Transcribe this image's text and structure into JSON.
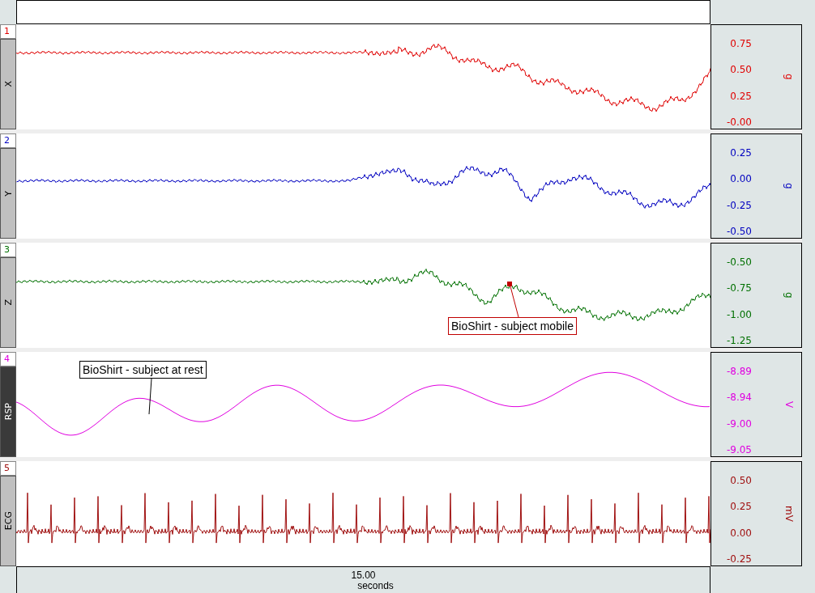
{
  "channels": [
    {
      "number": "1",
      "label": "X",
      "selected": false,
      "kind": "noisy",
      "color": "#e00000",
      "ticks": [
        "0.75",
        "0.50",
        "0.25",
        "-0.00"
      ],
      "unit": "g"
    },
    {
      "number": "2",
      "label": "Y",
      "selected": false,
      "kind": "noisy",
      "color": "#0000c0",
      "ticks": [
        "0.25",
        "0.00",
        "-0.25",
        "-0.50"
      ],
      "unit": "g"
    },
    {
      "number": "3",
      "label": "Z",
      "selected": false,
      "kind": "noisy",
      "color": "#007000",
      "ticks": [
        "-0.50",
        "-0.75",
        "-1.00",
        "-1.25"
      ],
      "unit": "g",
      "annotation": {
        "text": "BioShirt - subject mobile",
        "color": "#c00000"
      }
    },
    {
      "number": "4",
      "label": "RSP",
      "selected": true,
      "kind": "smooth",
      "color": "#e000e0",
      "ticks": [
        "-8.89",
        "-8.94",
        "-9.00",
        "-9.05"
      ],
      "unit": "V",
      "annotation": {
        "text": "BioShirt - subject at rest",
        "color": "#000000"
      }
    },
    {
      "number": "5",
      "label": "ECG",
      "selected": false,
      "kind": "ecg",
      "color": "#a01010",
      "ticks": [
        "0.50",
        "0.25",
        "0.00",
        "-0.25"
      ],
      "unit": "mV"
    }
  ],
  "time_axis": {
    "tick": "15.00",
    "label": "seconds"
  }
}
